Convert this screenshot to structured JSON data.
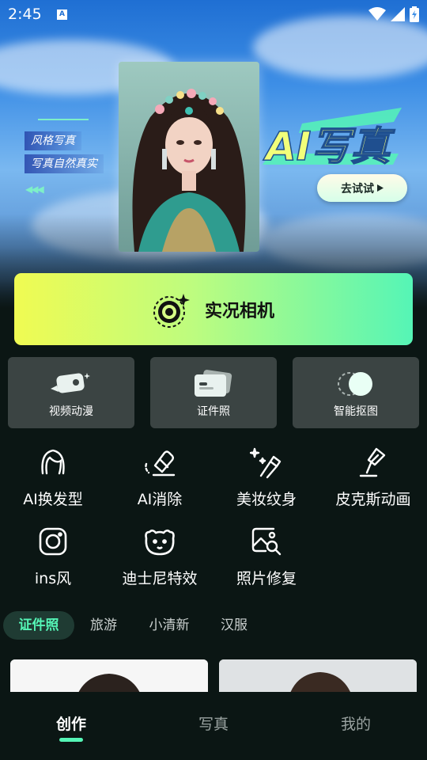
{
  "status_bar": {
    "time": "2:45",
    "notification_badge": "A",
    "icons": [
      "wifi-icon",
      "signal-icon",
      "battery-icon"
    ]
  },
  "hero": {
    "taglines": [
      "风格写真",
      "写真自然真实"
    ],
    "title": "AI写真",
    "try_button": "去试试"
  },
  "live_camera": {
    "label": "实况相机"
  },
  "feature_cards": [
    {
      "label": "视频动漫",
      "icon": "video-camera-icon"
    },
    {
      "label": "证件照",
      "icon": "id-card-icon"
    },
    {
      "label": "智能抠图",
      "icon": "cutout-circle-icon"
    }
  ],
  "tools": [
    {
      "label": "AI换发型",
      "icon": "hair-icon"
    },
    {
      "label": "AI消除",
      "icon": "eraser-icon"
    },
    {
      "label": "美妆纹身",
      "icon": "makeup-wand-icon"
    },
    {
      "label": "皮克斯动画",
      "icon": "lamp-icon"
    },
    {
      "label": "ins风",
      "icon": "instagram-icon"
    },
    {
      "label": "迪士尼特效",
      "icon": "bear-icon"
    },
    {
      "label": "照片修复",
      "icon": "photo-repair-icon"
    }
  ],
  "categories": {
    "active": "证件照",
    "items": [
      "证件照",
      "旅游",
      "小清新",
      "汉服"
    ]
  },
  "bottom_nav": {
    "active": "创作",
    "items": [
      "创作",
      "写真",
      "我的"
    ]
  },
  "colors": {
    "accent": "#55f5b6",
    "live_gradient_start": "#f0fb52",
    "background": "#0b1614",
    "card": "#3b4443"
  }
}
